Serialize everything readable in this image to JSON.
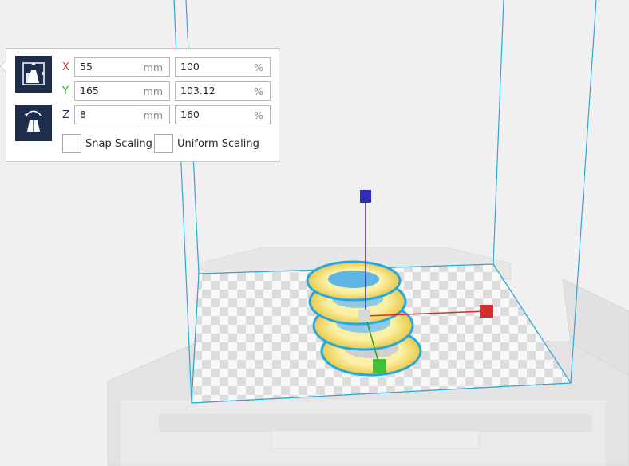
{
  "scale_panel": {
    "x": {
      "axis_label": "X",
      "mm_value": "55",
      "mm_unit": "mm",
      "pct_value": "100",
      "pct_unit": "%"
    },
    "y": {
      "axis_label": "Y",
      "mm_value": "165",
      "mm_unit": "mm",
      "pct_value": "103.12",
      "pct_unit": "%"
    },
    "z": {
      "axis_label": "Z",
      "mm_value": "8",
      "mm_unit": "mm",
      "pct_value": "160",
      "pct_unit": "%"
    },
    "snap_scaling": {
      "label": "Snap Scaling",
      "checked": false
    },
    "uniform_scaling": {
      "label": "Uniform Scaling",
      "checked": false
    }
  },
  "colors": {
    "accent": "#1f2d4d",
    "x_axis": "#d32f2f",
    "y_axis": "#3a9d23",
    "z_axis": "#2d2db8",
    "build_volume": "#2aa7d6",
    "model": "#f5e58a",
    "model_outline": "#23a8e0"
  },
  "tools": [
    "scale-tool-icon",
    "mirror-tool-icon"
  ]
}
